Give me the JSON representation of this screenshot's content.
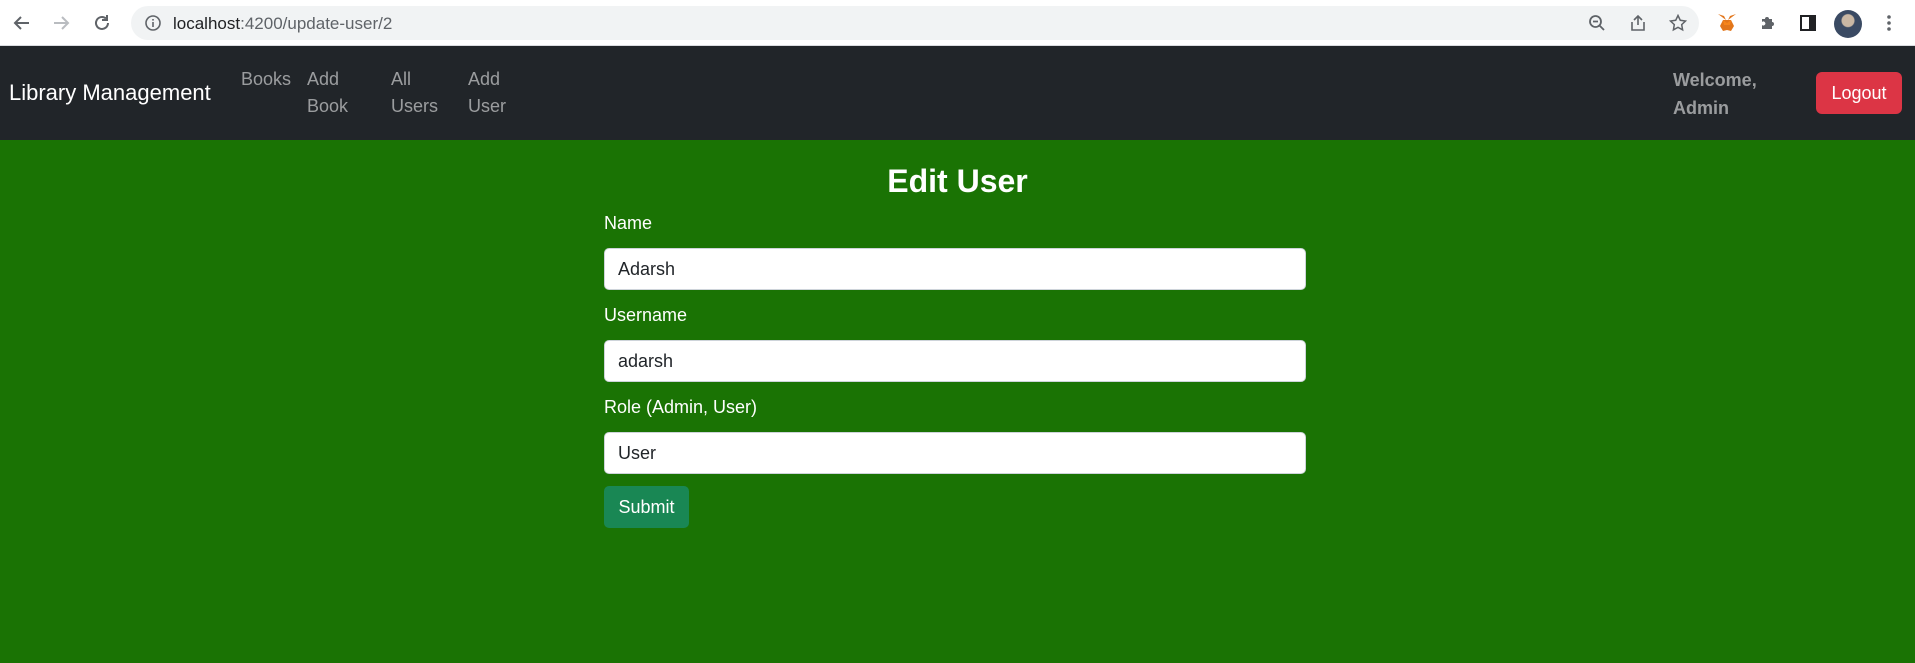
{
  "browser": {
    "url_host": "localhost",
    "url_path": ":4200/update-user/2"
  },
  "navbar": {
    "brand": "Library Management",
    "links": [
      {
        "line1": "Books",
        "line2": ""
      },
      {
        "line1": "Add",
        "line2": "Book"
      },
      {
        "line1": "All",
        "line2": "Users"
      },
      {
        "line1": "Add",
        "line2": "User"
      }
    ],
    "welcome_line1": "Welcome,",
    "welcome_line2": "Admin",
    "logout_label": "Logout"
  },
  "form": {
    "title": "Edit User",
    "name_label": "Name",
    "name_value": "Adarsh",
    "username_label": "Username",
    "username_value": "adarsh",
    "role_label": "Role (Admin, User)",
    "role_value": "User",
    "submit_label": "Submit"
  },
  "colors": {
    "page_background": "#1a7304",
    "navbar_background": "#212529",
    "logout_button": "#dc3545",
    "submit_button": "#198754"
  }
}
